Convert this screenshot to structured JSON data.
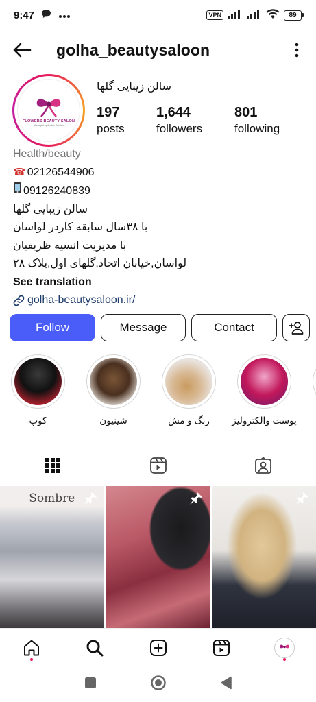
{
  "status_bar": {
    "time": "9:47",
    "vpn": "VPN",
    "battery": "89"
  },
  "header": {
    "username": "golha_beautysaloon"
  },
  "avatar": {
    "logo_title": "FLOWERS BEAUTY SALON",
    "logo_sub": "Managed by Ensieh Zarifian"
  },
  "profile": {
    "name": "سالن زیبایی گلها",
    "stats": [
      {
        "value": "197",
        "label": "posts"
      },
      {
        "value": "1,644",
        "label": "followers"
      },
      {
        "value": "801",
        "label": "following"
      }
    ]
  },
  "bio": {
    "category": "Health/beauty",
    "phone1": "02126544906",
    "phone2": "09126240839",
    "line1": "سالن زیبایی گلها",
    "line2": "با ۳۸سال سابقه کاردر لواسان",
    "line3": "با مدیریت انسیه ظریفیان",
    "line4": "لواسان,خیابان اتحاد,گلهای اول,پلاک ۲۸",
    "see_translation": "See translation",
    "link": "golha-beautysaloon.ir/"
  },
  "actions": {
    "follow": "Follow",
    "message": "Message",
    "contact": "Contact"
  },
  "highlights": [
    {
      "label": "کوپ"
    },
    {
      "label": "شینیون"
    },
    {
      "label": "رنگ و مش"
    },
    {
      "label": "پوست والکترولیز"
    }
  ],
  "posts": [
    {
      "caption": "Sombre"
    },
    {
      "caption": ""
    },
    {
      "caption": ""
    }
  ],
  "colors": {
    "follow_button": "#4a5df9",
    "notification_dot": "#e8195a",
    "link": "#1d3b6b"
  }
}
